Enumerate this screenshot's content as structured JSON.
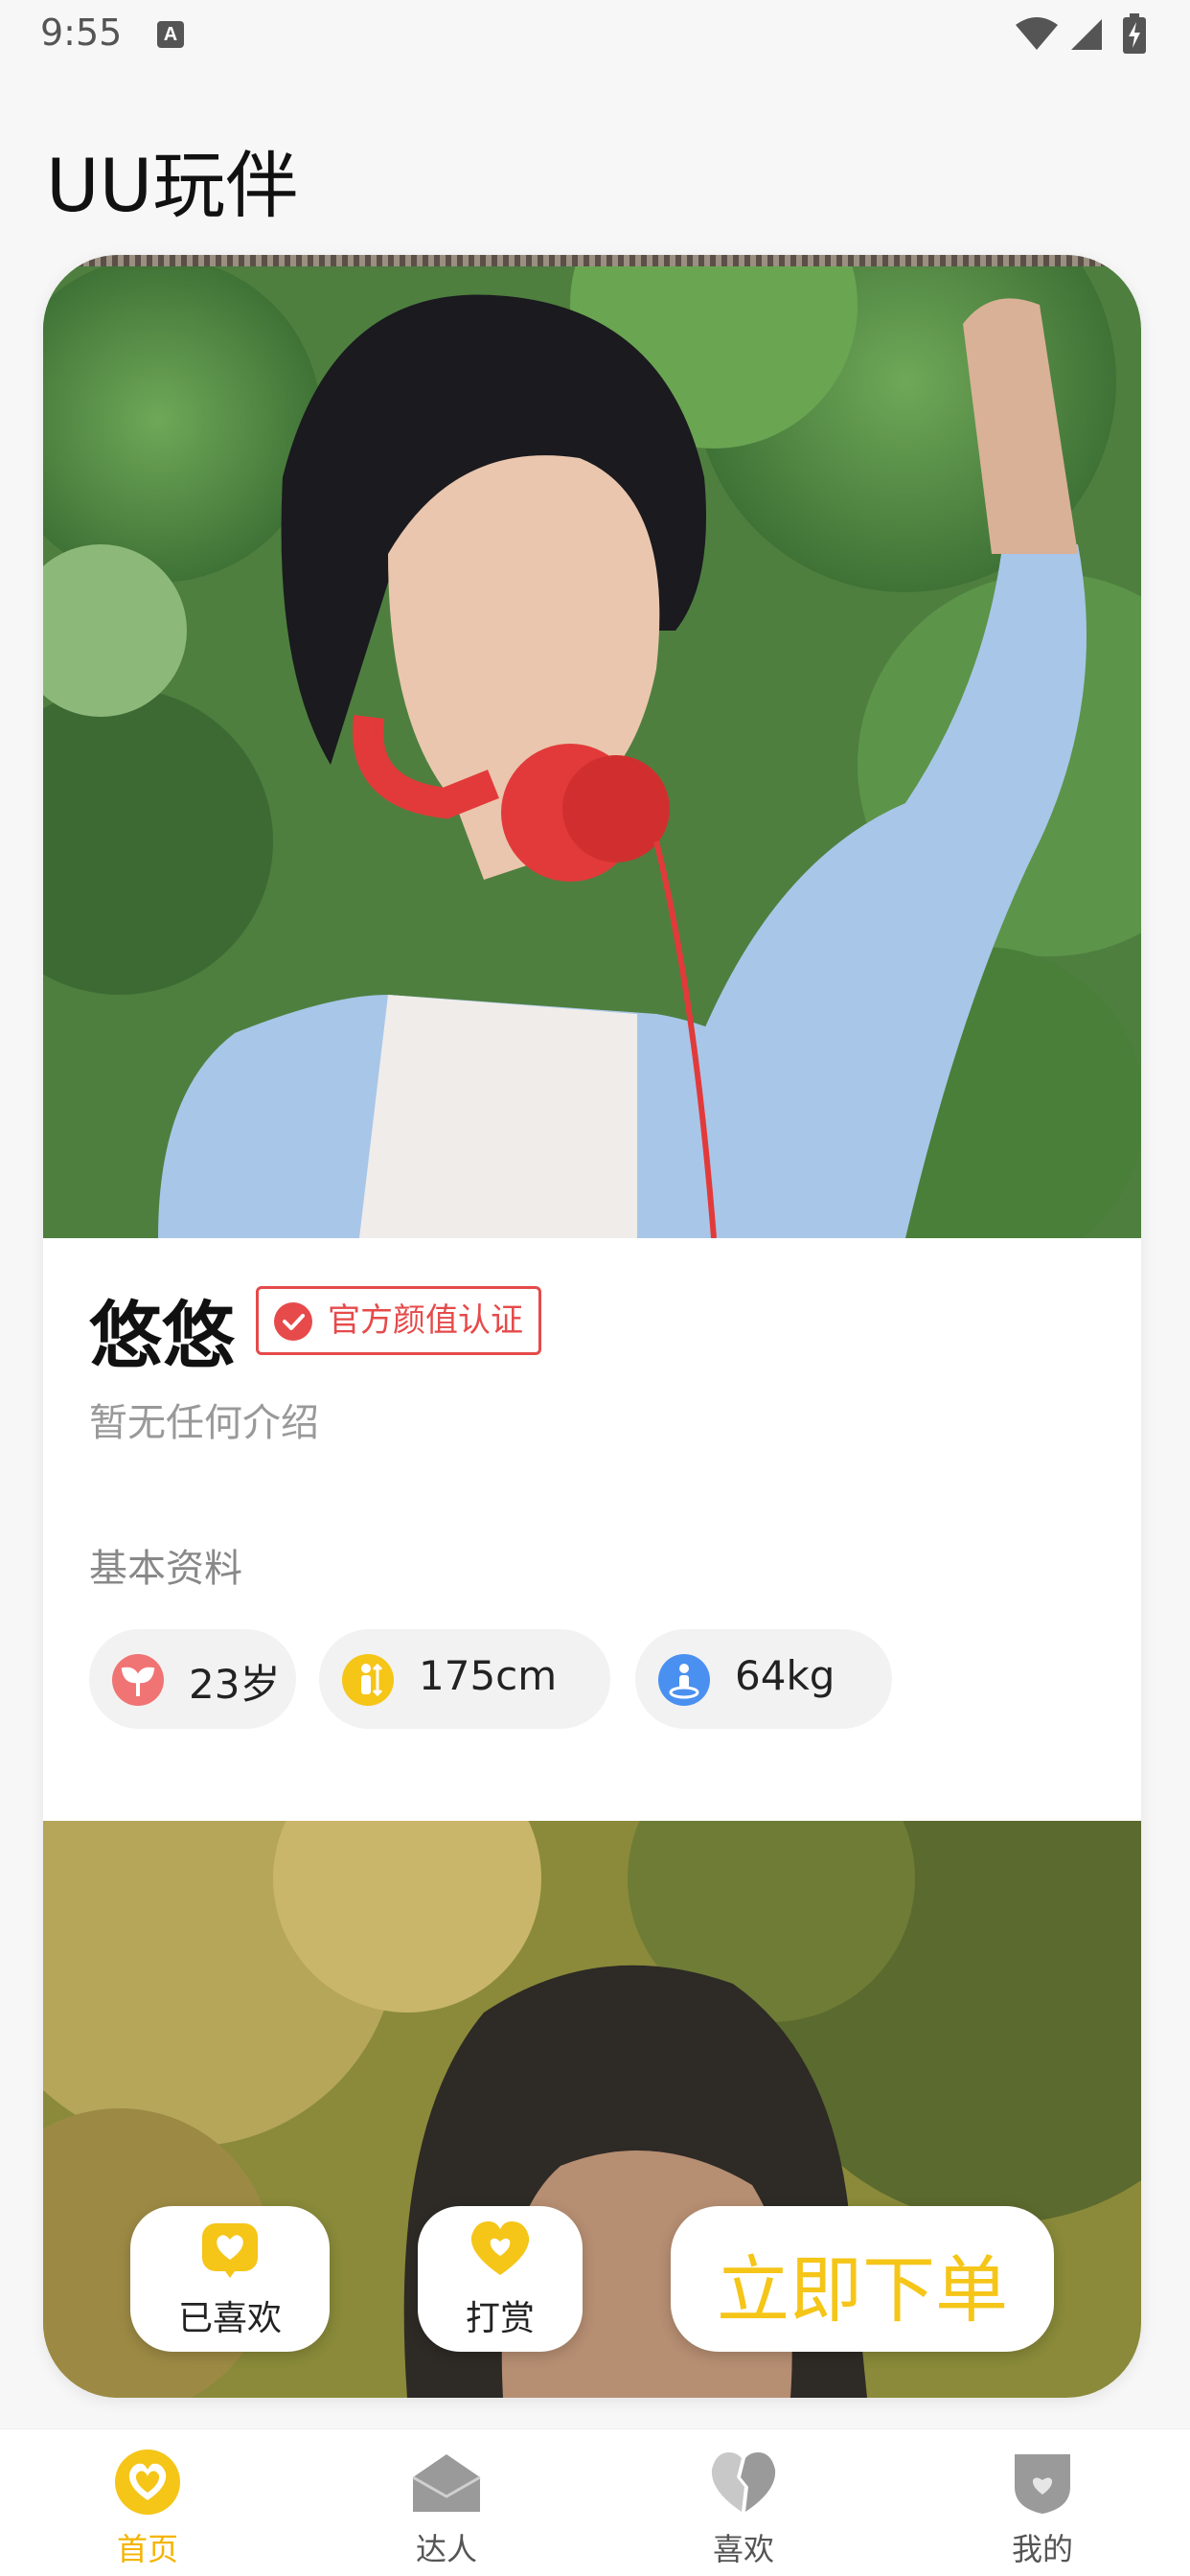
{
  "status_bar": {
    "time": "9:55",
    "notification_icon": "a-keyboard-icon",
    "icons": [
      "wifi-icon",
      "signal-icon",
      "battery-charging-icon"
    ]
  },
  "app": {
    "title": "UU玩伴"
  },
  "profile": {
    "name": "悠悠",
    "badge": "官方颜值认证",
    "intro": "暂无任何介绍",
    "section_label": "基本资料",
    "stats": {
      "age": "23岁",
      "height": "175cm",
      "weight": "64kg"
    }
  },
  "actions": {
    "liked_label": "已喜欢",
    "tip_label": "打赏",
    "order_label": "立即下单"
  },
  "nav": {
    "home": "首页",
    "talent": "达人",
    "likes": "喜欢",
    "mine": "我的"
  },
  "colors": {
    "accent": "#f5c518",
    "badge_red": "#e64a4a",
    "age_icon": "#f07474",
    "height_icon": "#f5c518",
    "weight_icon": "#4a90f0"
  }
}
